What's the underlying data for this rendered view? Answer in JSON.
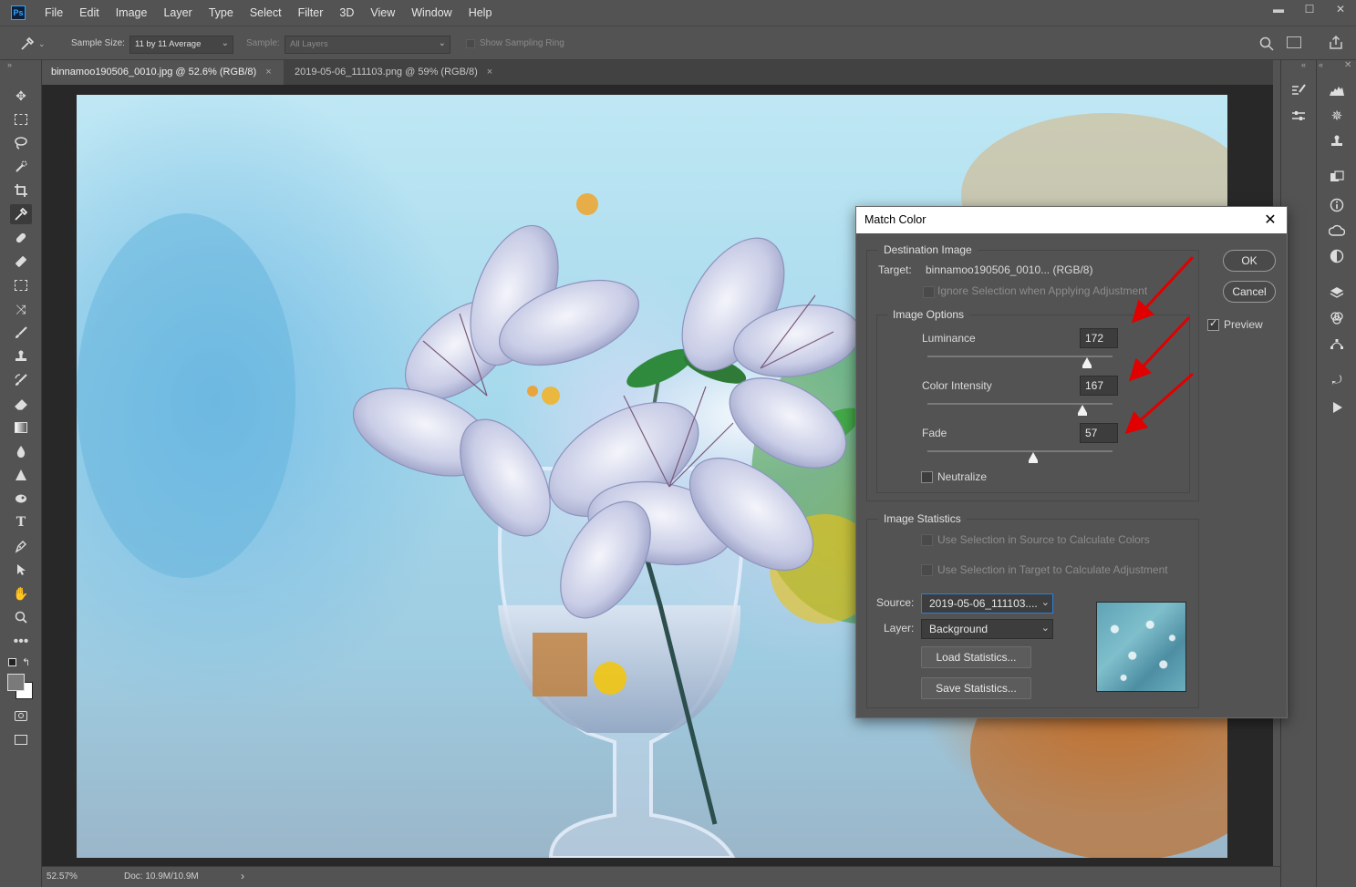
{
  "app": {
    "logo": "Ps"
  },
  "menu": [
    "File",
    "Edit",
    "Image",
    "Layer",
    "Type",
    "Select",
    "Filter",
    "3D",
    "View",
    "Window",
    "Help"
  ],
  "window_controls": {
    "minimize": "▬",
    "maximize": "☐",
    "close": "✕"
  },
  "options_bar": {
    "sample_size_label": "Sample Size:",
    "sample_size_value": "11 by 11 Average",
    "sample_label": "Sample:",
    "sample_value": "All Layers",
    "show_sampling_ring": "Show Sampling Ring"
  },
  "tabs": [
    {
      "label": "binnamoo190506_0010.jpg @ 52.6% (RGB/8)",
      "close": "×"
    },
    {
      "label": "2019-05-06_111103.png @ 59% (RGB/8)",
      "close": "×"
    }
  ],
  "status": {
    "zoom": "52.57%",
    "doc": "Doc: 10.9M/10.9M",
    "arrow": "›"
  },
  "tools": [
    "move-tool",
    "marquee-tool",
    "lasso-tool",
    "quick-select-tool",
    "crop-tool",
    "eyedropper-tool",
    "healing-brush-tool",
    "brush-tool",
    "clone-stamp-tool",
    "history-brush-tool",
    "eraser-tool",
    "gradient-tool",
    "blur-tool",
    "sharpen-tool",
    "dodge-tool",
    "type-tool",
    "pen-tool",
    "path-selection-tool",
    "hand-tool",
    "zoom-tool",
    "more-tools-icon"
  ],
  "dialog": {
    "title": "Match Color",
    "close": "✕",
    "destination_group": "Destination Image",
    "target_label": "Target:",
    "target_value": "binnamoo190506_0010... (RGB/8)",
    "ignore_selection": "Ignore Selection when Applying Adjustment",
    "image_options_group": "Image Options",
    "luminance_label": "Luminance",
    "luminance_value": "172",
    "color_intensity_label": "Color Intensity",
    "color_intensity_value": "167",
    "fade_label": "Fade",
    "fade_value": "57",
    "sliders": {
      "luminance": 0.86,
      "color_intensity": 0.835,
      "fade": 0.57
    },
    "neutralize": "Neutralize",
    "image_statistics_group": "Image Statistics",
    "use_sel_source": "Use Selection in Source to Calculate Colors",
    "use_sel_target": "Use Selection in Target to Calculate Adjustment",
    "source_label": "Source:",
    "source_value": "2019-05-06_111103....",
    "layer_label": "Layer:",
    "layer_value": "Background",
    "load_stats": "Load Statistics...",
    "save_stats": "Save Statistics...",
    "ok": "OK",
    "cancel": "Cancel",
    "preview": "Preview",
    "preview_checked": true
  },
  "colors": {
    "accent_focus": "#2d7fd8",
    "annotation_arrow": "#e00000"
  }
}
